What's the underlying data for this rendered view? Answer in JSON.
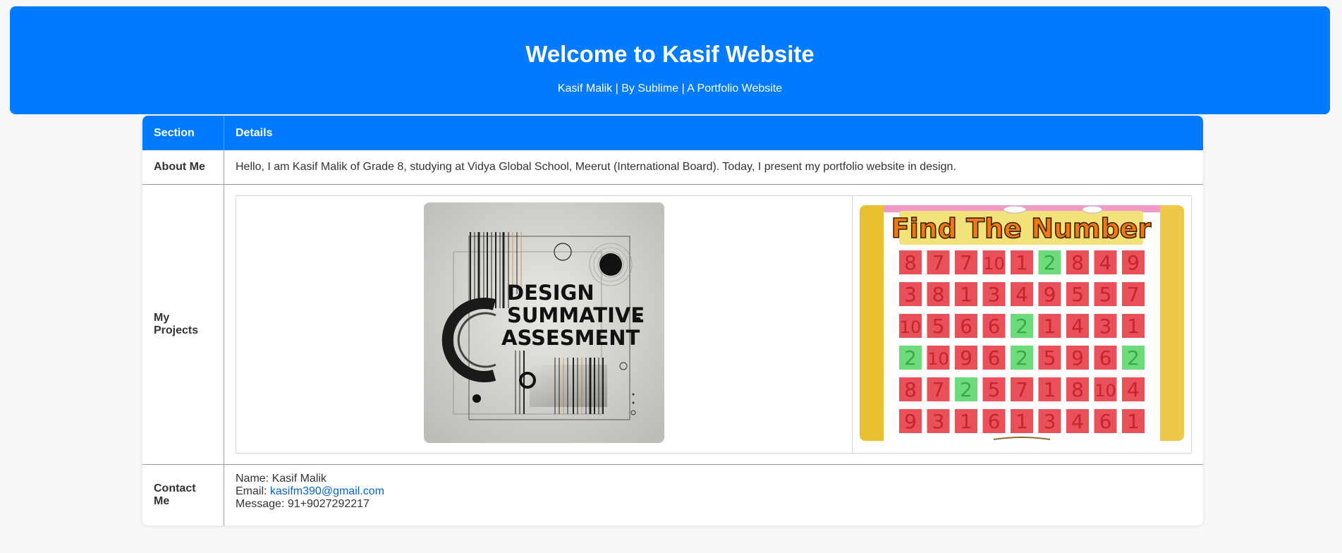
{
  "header": {
    "title": "Welcome to Kasif Website",
    "subtitle": "Kasif Malik | By Sublime | A Portfolio Website"
  },
  "table": {
    "col_section": "Section",
    "col_details": "Details",
    "about": {
      "label": "About Me",
      "text": "Hello, I am Kasif Malik of Grade 8, studying at Vidya Global School, Meerut (International Board). Today, I present my portfolio website in design."
    },
    "projects": {
      "label": "My Projects",
      "design_poster": {
        "lines": [
          "DESIGN",
          "SUMMATIVE",
          "ASSESMENT"
        ]
      },
      "game_poster": {
        "title": "Find The Number",
        "grid": [
          [
            "8",
            "7",
            "7",
            "10",
            "1",
            "2",
            "8",
            "4",
            "9"
          ],
          [
            "3",
            "8",
            "1",
            "3",
            "4",
            "9",
            "5",
            "5",
            "7"
          ],
          [
            "10",
            "5",
            "6",
            "6",
            "2",
            "1",
            "4",
            "3",
            "1"
          ],
          [
            "2",
            "10",
            "9",
            "6",
            "2",
            "5",
            "9",
            "6",
            "2"
          ],
          [
            "8",
            "7",
            "2",
            "5",
            "7",
            "1",
            "8",
            "10",
            "4"
          ],
          [
            "9",
            "3",
            "1",
            "6",
            "1",
            "3",
            "4",
            "6",
            "1"
          ]
        ],
        "highlighted": [
          "2"
        ]
      }
    },
    "contact": {
      "label": "Contact Me",
      "name_line": "Name: Kasif Malik",
      "email_prefix": "Email: ",
      "email": "kasifm390@gmail.com",
      "message_line": "Message: 91+9027292217"
    }
  },
  "colors": {
    "brand": "#007bff",
    "page_bg": "#f7f8fa",
    "tile_red": "#e8515a",
    "tile_green": "#6cdc7a"
  }
}
